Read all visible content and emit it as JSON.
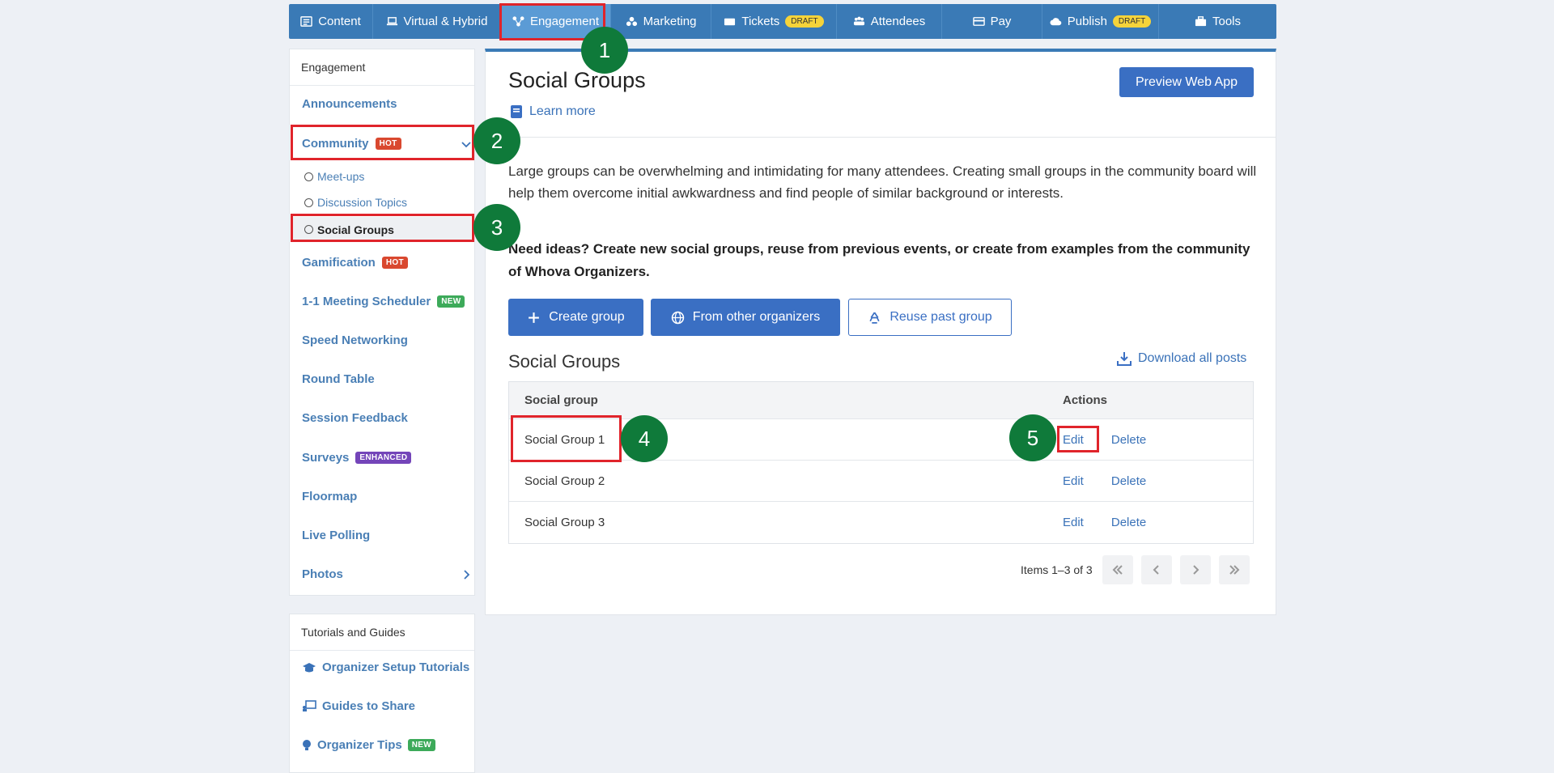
{
  "nav": {
    "tabs": [
      {
        "label": "Content"
      },
      {
        "label": "Virtual & Hybrid"
      },
      {
        "label": "Engagement"
      },
      {
        "label": "Marketing"
      },
      {
        "label": "Tickets",
        "badge": "DRAFT"
      },
      {
        "label": "Attendees"
      },
      {
        "label": "Pay"
      },
      {
        "label": "Publish",
        "badge": "DRAFT"
      },
      {
        "label": "Tools"
      }
    ]
  },
  "sidebar": {
    "header": "Engagement",
    "items": {
      "announcements": "Announcements",
      "community": "Community",
      "community_badge": "HOT",
      "meetups": "Meet-ups",
      "discussion": "Discussion Topics",
      "social_groups": "Social Groups",
      "gamification": "Gamification",
      "gamification_badge": "HOT",
      "meeting": "1-1 Meeting Scheduler",
      "meeting_badge": "NEW",
      "speed": "Speed Networking",
      "round": "Round Table",
      "feedback": "Session Feedback",
      "surveys": "Surveys",
      "surveys_badge": "ENHANCED",
      "floormap": "Floormap",
      "polling": "Live Polling",
      "photos": "Photos"
    }
  },
  "tutorials": {
    "header": "Tutorials and Guides",
    "setup": "Organizer Setup Tutorials",
    "guides": "Guides to Share",
    "tips": "Organizer Tips",
    "tips_badge": "NEW"
  },
  "main": {
    "title": "Social Groups",
    "learn_more": "Learn more",
    "preview_button": "Preview Web App",
    "description": "Large groups can be overwhelming and intimidating for many attendees. Creating small groups in the community board will help them overcome initial awkwardness and find people of similar background or interests.",
    "ideas": "Need ideas? Create new social groups, reuse from previous events, or create from examples from the community of Whova Organizers.",
    "create_button": "Create group",
    "other_button": "From other organizers",
    "reuse_button": "Reuse past group",
    "section_title": "Social Groups",
    "download": "Download all posts",
    "table": {
      "col_group": "Social group",
      "col_actions": "Actions",
      "rows": [
        {
          "name": "Social Group 1",
          "edit": "Edit",
          "delete": "Delete"
        },
        {
          "name": "Social Group 2",
          "edit": "Edit",
          "delete": "Delete"
        },
        {
          "name": "Social Group 3",
          "edit": "Edit",
          "delete": "Delete"
        }
      ]
    },
    "pager": "Items 1–3 of 3"
  },
  "annotations": [
    "1",
    "2",
    "3",
    "4",
    "5"
  ]
}
